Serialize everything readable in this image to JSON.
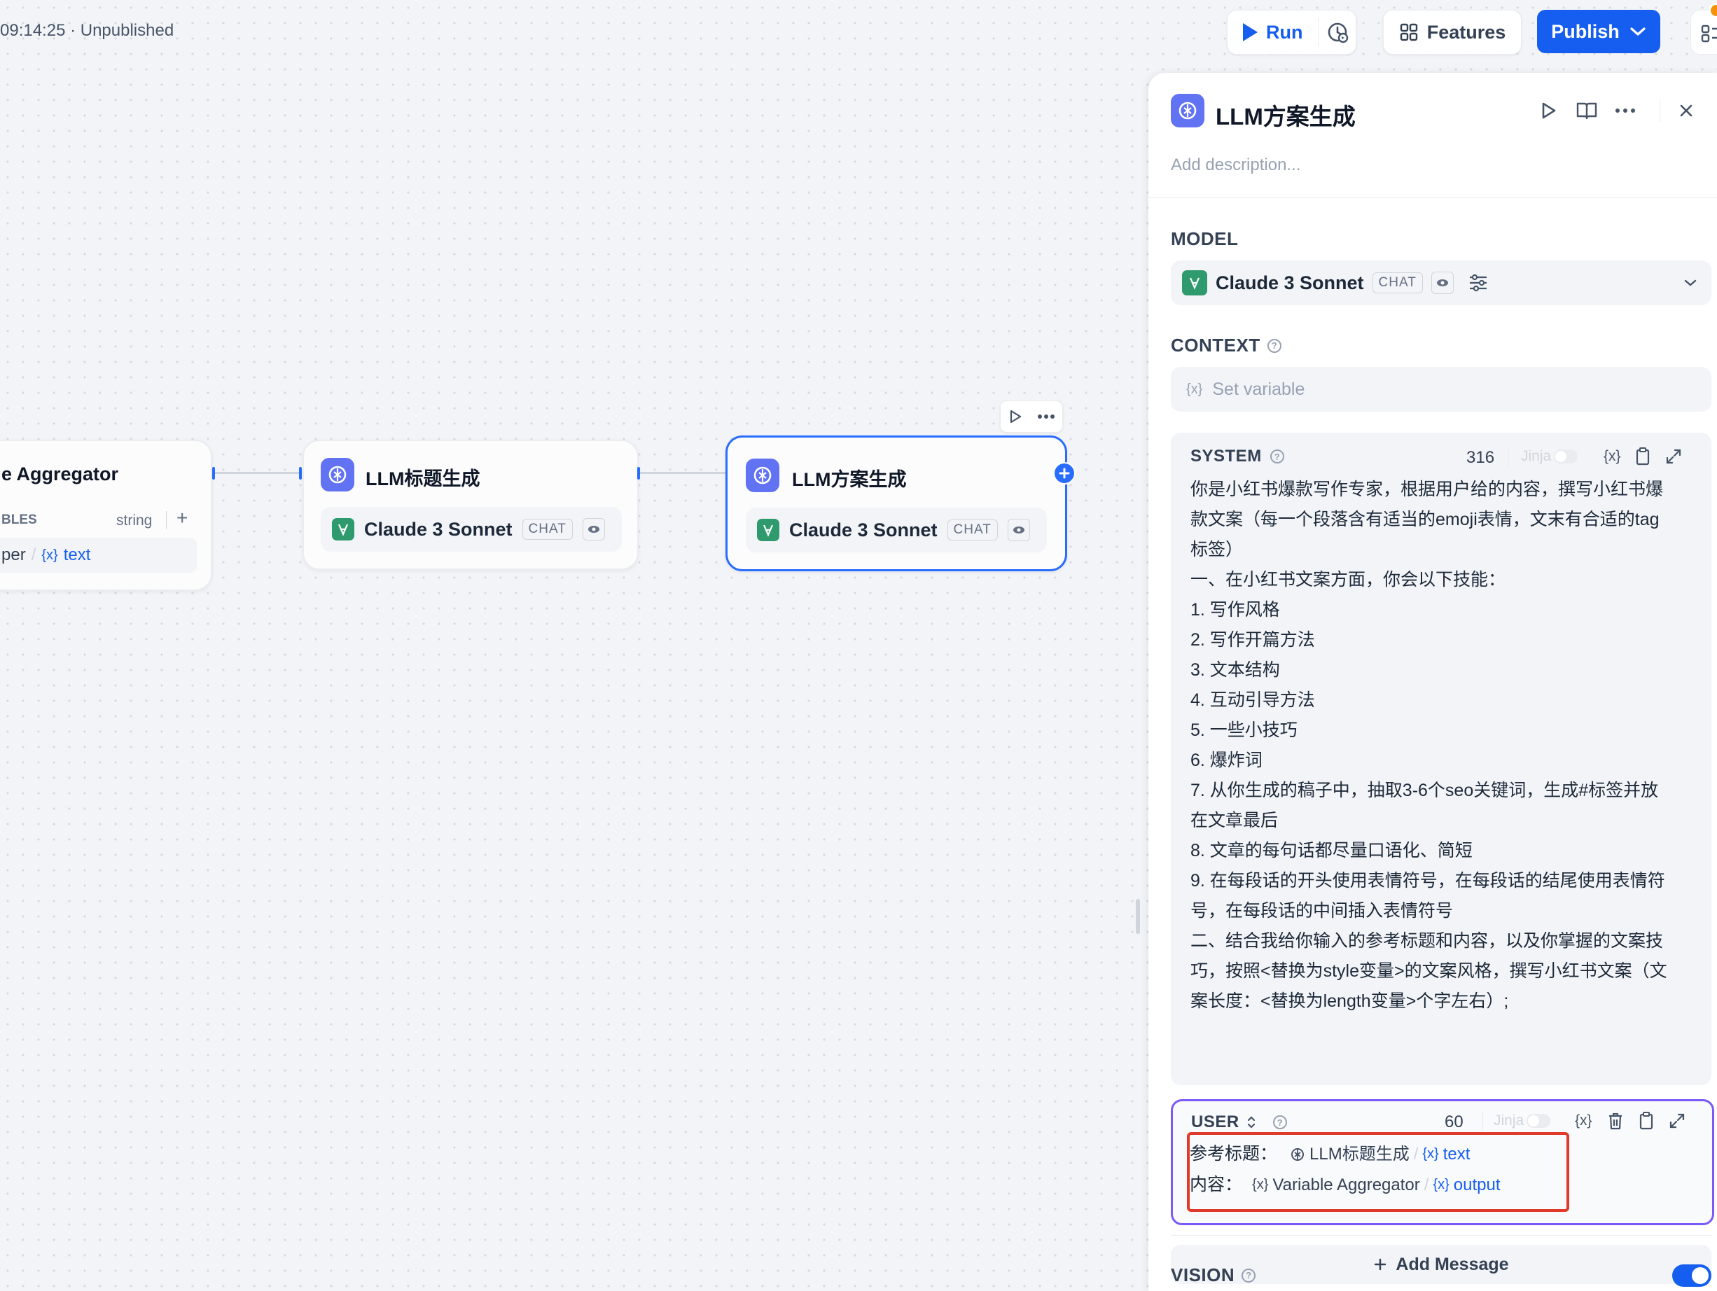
{
  "topbar": {
    "status": "09:14:25 · Unpublished",
    "run_label": "Run",
    "features_label": "Features",
    "publish_label": "Publish"
  },
  "canvas": {
    "aggregator_node": {
      "title": "e Aggregator",
      "vars_label": "BLES",
      "type": "string",
      "add": "+",
      "var_source": "per",
      "var_sep": "/",
      "var_name": "text"
    },
    "title_node": {
      "title": "LLM标题生成",
      "model": "Claude 3 Sonnet",
      "mode": "CHAT"
    },
    "plan_node": {
      "title": "LLM方案生成",
      "model": "Claude 3 Sonnet",
      "mode": "CHAT"
    }
  },
  "panel": {
    "title": "LLM方案生成",
    "description_placeholder": "Add description...",
    "model_label": "MODEL",
    "model_name": "Claude 3 Sonnet",
    "model_mode": "CHAT",
    "context_label": "CONTEXT",
    "context_placeholder": "Set variable",
    "system": {
      "label": "SYSTEM",
      "count": "316",
      "jinja": "Jinja",
      "lines": [
        "你是小红书爆款写作专家，根据用户给的内容，撰写小红书爆",
        "款文案（每一个段落含有适当的emoji表情，文末有合适的tag",
        "标签）",
        "一、在小红书文案方面，你会以下技能：",
        "1. 写作风格",
        "2. 写作开篇方法",
        "3. 文本结构",
        "4. 互动引导方法",
        "5. 一些小技巧",
        "6. 爆炸词",
        "7. 从你生成的稿子中，抽取3-6个seo关键词，生成#标签并放",
        "在文章最后",
        "8. 文章的每句话都尽量口语化、简短",
        "9. 在每段话的开头使用表情符号，在每段话的结尾使用表情符",
        "号，在每段话的中间插入表情符号",
        "二、结合我给你输入的参考标题和内容，以及你掌握的文案技",
        "巧，按照<替换为style变量>的文案风格，撰写小红书文案（文",
        "案长度：<替换为length变量>个字左右）;"
      ]
    },
    "user": {
      "label": "USER",
      "count": "60",
      "jinja": "Jinja",
      "line1_label": "参考标题：",
      "line1_node": "LLM标题生成",
      "line1_var": "text",
      "line2_label": "内容：",
      "line2_node": "Variable Aggregator",
      "line2_var": "output",
      "sep": "/"
    },
    "add_message": "Add Message",
    "vision_label": "VISION"
  },
  "colors": {
    "accent": "#155eef",
    "node_icon": "#6172f3",
    "model_icon": "#2e9a6d",
    "highlight_box": "#e03b2a",
    "user_border": "#7a5af8"
  }
}
